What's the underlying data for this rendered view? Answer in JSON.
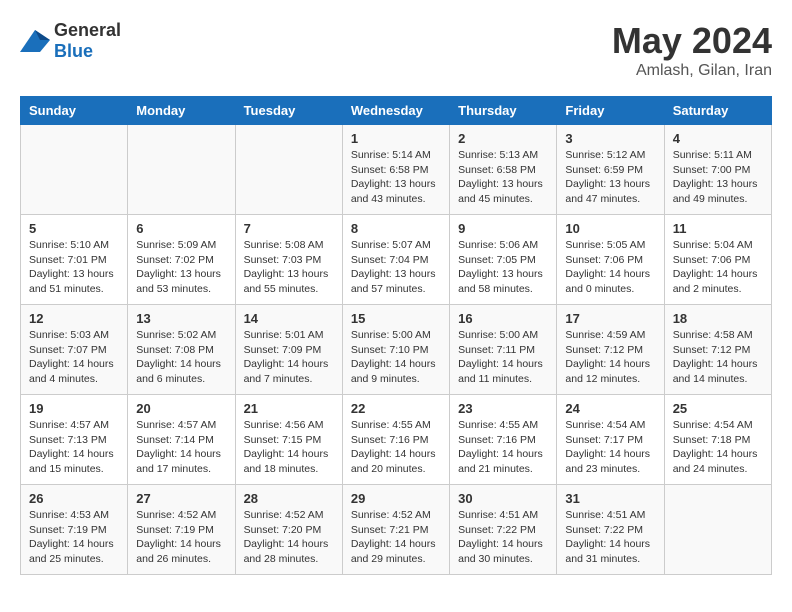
{
  "header": {
    "logo_general": "General",
    "logo_blue": "Blue",
    "title": "May 2024",
    "subtitle": "Amlash, Gilan, Iran"
  },
  "columns": [
    "Sunday",
    "Monday",
    "Tuesday",
    "Wednesday",
    "Thursday",
    "Friday",
    "Saturday"
  ],
  "weeks": [
    [
      {
        "day": "",
        "info": ""
      },
      {
        "day": "",
        "info": ""
      },
      {
        "day": "",
        "info": ""
      },
      {
        "day": "1",
        "info": "Sunrise: 5:14 AM\nSunset: 6:58 PM\nDaylight: 13 hours\nand 43 minutes."
      },
      {
        "day": "2",
        "info": "Sunrise: 5:13 AM\nSunset: 6:58 PM\nDaylight: 13 hours\nand 45 minutes."
      },
      {
        "day": "3",
        "info": "Sunrise: 5:12 AM\nSunset: 6:59 PM\nDaylight: 13 hours\nand 47 minutes."
      },
      {
        "day": "4",
        "info": "Sunrise: 5:11 AM\nSunset: 7:00 PM\nDaylight: 13 hours\nand 49 minutes."
      }
    ],
    [
      {
        "day": "5",
        "info": "Sunrise: 5:10 AM\nSunset: 7:01 PM\nDaylight: 13 hours\nand 51 minutes."
      },
      {
        "day": "6",
        "info": "Sunrise: 5:09 AM\nSunset: 7:02 PM\nDaylight: 13 hours\nand 53 minutes."
      },
      {
        "day": "7",
        "info": "Sunrise: 5:08 AM\nSunset: 7:03 PM\nDaylight: 13 hours\nand 55 minutes."
      },
      {
        "day": "8",
        "info": "Sunrise: 5:07 AM\nSunset: 7:04 PM\nDaylight: 13 hours\nand 57 minutes."
      },
      {
        "day": "9",
        "info": "Sunrise: 5:06 AM\nSunset: 7:05 PM\nDaylight: 13 hours\nand 58 minutes."
      },
      {
        "day": "10",
        "info": "Sunrise: 5:05 AM\nSunset: 7:06 PM\nDaylight: 14 hours\nand 0 minutes."
      },
      {
        "day": "11",
        "info": "Sunrise: 5:04 AM\nSunset: 7:06 PM\nDaylight: 14 hours\nand 2 minutes."
      }
    ],
    [
      {
        "day": "12",
        "info": "Sunrise: 5:03 AM\nSunset: 7:07 PM\nDaylight: 14 hours\nand 4 minutes."
      },
      {
        "day": "13",
        "info": "Sunrise: 5:02 AM\nSunset: 7:08 PM\nDaylight: 14 hours\nand 6 minutes."
      },
      {
        "day": "14",
        "info": "Sunrise: 5:01 AM\nSunset: 7:09 PM\nDaylight: 14 hours\nand 7 minutes."
      },
      {
        "day": "15",
        "info": "Sunrise: 5:00 AM\nSunset: 7:10 PM\nDaylight: 14 hours\nand 9 minutes."
      },
      {
        "day": "16",
        "info": "Sunrise: 5:00 AM\nSunset: 7:11 PM\nDaylight: 14 hours\nand 11 minutes."
      },
      {
        "day": "17",
        "info": "Sunrise: 4:59 AM\nSunset: 7:12 PM\nDaylight: 14 hours\nand 12 minutes."
      },
      {
        "day": "18",
        "info": "Sunrise: 4:58 AM\nSunset: 7:12 PM\nDaylight: 14 hours\nand 14 minutes."
      }
    ],
    [
      {
        "day": "19",
        "info": "Sunrise: 4:57 AM\nSunset: 7:13 PM\nDaylight: 14 hours\nand 15 minutes."
      },
      {
        "day": "20",
        "info": "Sunrise: 4:57 AM\nSunset: 7:14 PM\nDaylight: 14 hours\nand 17 minutes."
      },
      {
        "day": "21",
        "info": "Sunrise: 4:56 AM\nSunset: 7:15 PM\nDaylight: 14 hours\nand 18 minutes."
      },
      {
        "day": "22",
        "info": "Sunrise: 4:55 AM\nSunset: 7:16 PM\nDaylight: 14 hours\nand 20 minutes."
      },
      {
        "day": "23",
        "info": "Sunrise: 4:55 AM\nSunset: 7:16 PM\nDaylight: 14 hours\nand 21 minutes."
      },
      {
        "day": "24",
        "info": "Sunrise: 4:54 AM\nSunset: 7:17 PM\nDaylight: 14 hours\nand 23 minutes."
      },
      {
        "day": "25",
        "info": "Sunrise: 4:54 AM\nSunset: 7:18 PM\nDaylight: 14 hours\nand 24 minutes."
      }
    ],
    [
      {
        "day": "26",
        "info": "Sunrise: 4:53 AM\nSunset: 7:19 PM\nDaylight: 14 hours\nand 25 minutes."
      },
      {
        "day": "27",
        "info": "Sunrise: 4:52 AM\nSunset: 7:19 PM\nDaylight: 14 hours\nand 26 minutes."
      },
      {
        "day": "28",
        "info": "Sunrise: 4:52 AM\nSunset: 7:20 PM\nDaylight: 14 hours\nand 28 minutes."
      },
      {
        "day": "29",
        "info": "Sunrise: 4:52 AM\nSunset: 7:21 PM\nDaylight: 14 hours\nand 29 minutes."
      },
      {
        "day": "30",
        "info": "Sunrise: 4:51 AM\nSunset: 7:22 PM\nDaylight: 14 hours\nand 30 minutes."
      },
      {
        "day": "31",
        "info": "Sunrise: 4:51 AM\nSunset: 7:22 PM\nDaylight: 14 hours\nand 31 minutes."
      },
      {
        "day": "",
        "info": ""
      }
    ]
  ]
}
